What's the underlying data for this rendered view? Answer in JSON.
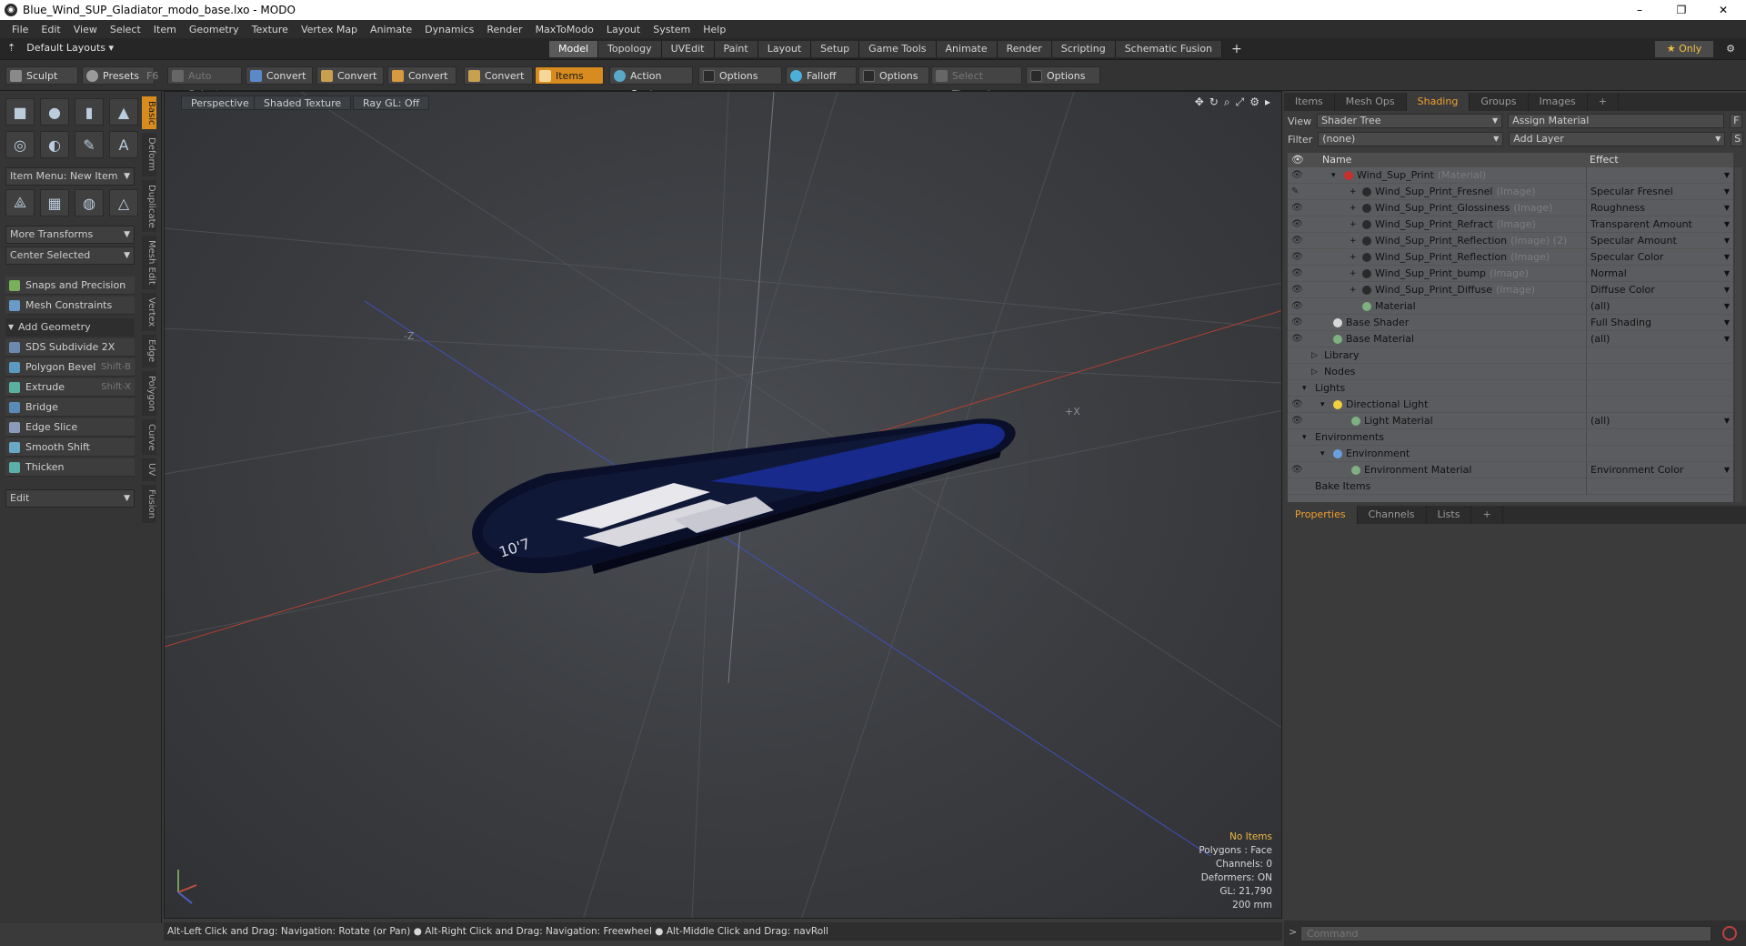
{
  "window": {
    "title": "Blue_Wind_SUP_Gladiator_modo_base.lxo - MODO",
    "minimize": "–",
    "maximize": "❐",
    "close": "✕"
  },
  "menu": [
    "File",
    "Edit",
    "View",
    "Select",
    "Item",
    "Geometry",
    "Texture",
    "Vertex Map",
    "Animate",
    "Dynamics",
    "Render",
    "MaxToModo",
    "Layout",
    "System",
    "Help"
  ],
  "layout_bar": {
    "layouts_label": "Default Layouts ▾",
    "tabs": [
      "Model",
      "Topology",
      "UVEdit",
      "Paint",
      "Layout",
      "Setup",
      "Game Tools",
      "Animate",
      "Render",
      "Scripting",
      "Schematic Fusion"
    ],
    "active_tab": "Model",
    "add_tab": "+",
    "only_label": "★ Only"
  },
  "toolbar": {
    "sculpt": "Sculpt",
    "presets": "Presets",
    "presets_key": "F6",
    "auto_select": "Auto Select",
    "convert1": "Convert",
    "convert2": "Convert",
    "convert3": "Convert",
    "convert4": "Convert",
    "items": "Items",
    "action_center": "Action Center",
    "options1": "Options",
    "falloff": "Falloff",
    "options2": "Options",
    "select_through": "Select Through",
    "options3": "Options"
  },
  "left_panel": {
    "item_menu": "Item Menu: New Item",
    "more_transforms": "More Transforms",
    "center_selected": "Center Selected",
    "snaps": "Snaps and Precision",
    "mesh_constraints": "Mesh Constraints",
    "add_geometry": "Add Geometry",
    "tools": [
      {
        "label": "SDS Subdivide 2X",
        "shortcut": ""
      },
      {
        "label": "Polygon Bevel",
        "shortcut": "Shift-B"
      },
      {
        "label": "Extrude",
        "shortcut": "Shift-X"
      },
      {
        "label": "Bridge",
        "shortcut": ""
      },
      {
        "label": "Edge Slice",
        "shortcut": ""
      },
      {
        "label": "Smooth Shift",
        "shortcut": ""
      },
      {
        "label": "Thicken",
        "shortcut": ""
      }
    ],
    "edit_dropdown": "Edit",
    "vertical_tabs": [
      "Basic",
      "Deform",
      "Duplicate",
      "Mesh Edit",
      "Vertex",
      "Edge",
      "Polygon",
      "Curve",
      "UV",
      "Fusion"
    ]
  },
  "viewport": {
    "perspective": "Perspective",
    "shaded": "Shaded Texture",
    "raygl": "Ray GL: Off",
    "stats": {
      "no_items": "No Items",
      "polygons": "Polygons : Face",
      "channels": "Channels: 0",
      "deformers": "Deformers: ON",
      "gl": "GL: 21,790",
      "scale": "200 mm"
    },
    "axis_labels": {
      "z": "-Z",
      "x": "+X"
    },
    "board_text": "10'7"
  },
  "status_bar": {
    "hint": "Alt-Left Click and Drag: Navigation: Rotate (or Pan) ● Alt-Right Click and Drag: Navigation: Freewheel ● Alt-Middle Click and Drag: navRoll"
  },
  "right_panel": {
    "top_tabs": [
      "Items",
      "Mesh Ops",
      "Shading",
      "Groups",
      "Images",
      "+"
    ],
    "active_top_tab": "Shading",
    "view_label": "View",
    "view_value": "Shader Tree",
    "assign_material": "Assign Material",
    "assign_key": "F",
    "filter_label": "Filter",
    "filter_value": "(none)",
    "add_layer": "Add Layer",
    "add_layer_key": "S",
    "col_name": "Name",
    "col_effect": "Effect",
    "tree": [
      {
        "name": "Wind_Sup_Print",
        "type": "(Material)",
        "effect": "",
        "indent": 62,
        "ball": "#c8302c",
        "eye": "👁",
        "exp": "▾"
      },
      {
        "name": "Wind_Sup_Print_Fresnel",
        "type": "(Image)",
        "effect": "Specular Fresnel",
        "indent": 82,
        "ball": "#2a2a2a",
        "eye": "✎",
        "exp": "+"
      },
      {
        "name": "Wind_Sup_Print_Glossiness",
        "type": "(Image)",
        "effect": "Roughness",
        "indent": 82,
        "ball": "#2a2a2a",
        "eye": "👁",
        "exp": "+"
      },
      {
        "name": "Wind_Sup_Print_Refract",
        "type": "(Image)",
        "effect": "Transparent Amount",
        "indent": 82,
        "ball": "#2a2a2a",
        "eye": "👁",
        "exp": "+"
      },
      {
        "name": "Wind_Sup_Print_Reflection",
        "type": "(Image) (2)",
        "effect": "Specular Amount",
        "indent": 82,
        "ball": "#2a2a2a",
        "eye": "👁",
        "exp": "+"
      },
      {
        "name": "Wind_Sup_Print_Reflection",
        "type": "(Image)",
        "effect": "Specular Color",
        "indent": 82,
        "ball": "#2a2a2a",
        "eye": "👁",
        "exp": "+"
      },
      {
        "name": "Wind_Sup_Print_bump",
        "type": "(Image)",
        "effect": "Normal",
        "indent": 82,
        "ball": "#2a2a2a",
        "eye": "👁",
        "exp": "+"
      },
      {
        "name": "Wind_Sup_Print_Diffuse",
        "type": "(Image)",
        "effect": "Diffuse Color",
        "indent": 82,
        "ball": "#2a2a2a",
        "eye": "👁",
        "exp": "+"
      },
      {
        "name": "Material",
        "type": "",
        "effect": "(all)",
        "indent": 82,
        "ball": "#7fb07f",
        "eye": "👁",
        "exp": ""
      },
      {
        "name": "Base Shader",
        "type": "",
        "effect": "Full Shading",
        "indent": 50,
        "ball": "#d8d8d8",
        "eye": "👁",
        "exp": ""
      },
      {
        "name": "Base Material",
        "type": "",
        "effect": "(all)",
        "indent": 50,
        "ball": "#7fb07f",
        "eye": "👁",
        "exp": ""
      },
      {
        "name": "Library",
        "type": "",
        "effect": "",
        "indent": 40,
        "ball": "",
        "eye": "",
        "exp": "▷"
      },
      {
        "name": "Nodes",
        "type": "",
        "effect": "",
        "indent": 40,
        "ball": "",
        "eye": "",
        "exp": "▷"
      },
      {
        "name": "Lights",
        "type": "",
        "effect": "",
        "indent": 30,
        "ball": "",
        "eye": "",
        "exp": "▾"
      },
      {
        "name": "Directional Light",
        "type": "",
        "effect": "",
        "indent": 50,
        "ball": "#f0d040",
        "eye": "👁",
        "exp": "▾"
      },
      {
        "name": "Light Material",
        "type": "",
        "effect": "(all)",
        "indent": 70,
        "ball": "#7fb07f",
        "eye": "👁",
        "exp": ""
      },
      {
        "name": "Environments",
        "type": "",
        "effect": "",
        "indent": 30,
        "ball": "",
        "eye": "",
        "exp": "▾"
      },
      {
        "name": "Environment",
        "type": "",
        "effect": "",
        "indent": 50,
        "ball": "#6aa0e0",
        "eye": "",
        "exp": "▾"
      },
      {
        "name": "Environment Material",
        "type": "",
        "effect": "Environment Color",
        "indent": 70,
        "ball": "#7fb07f",
        "eye": "👁",
        "exp": ""
      },
      {
        "name": "Bake Items",
        "type": "",
        "effect": "",
        "indent": 30,
        "ball": "",
        "eye": "",
        "exp": ""
      }
    ],
    "bottom_tabs": [
      "Properties",
      "Channels",
      "Lists",
      "+"
    ],
    "active_bottom_tab": "Properties",
    "command_placeholder": "Command"
  },
  "colors": {
    "accent": "#d88b1e",
    "active_tab_text": "#f0a030",
    "board_dark": "#0a0f2a",
    "board_blue": "#1a2f9c"
  }
}
